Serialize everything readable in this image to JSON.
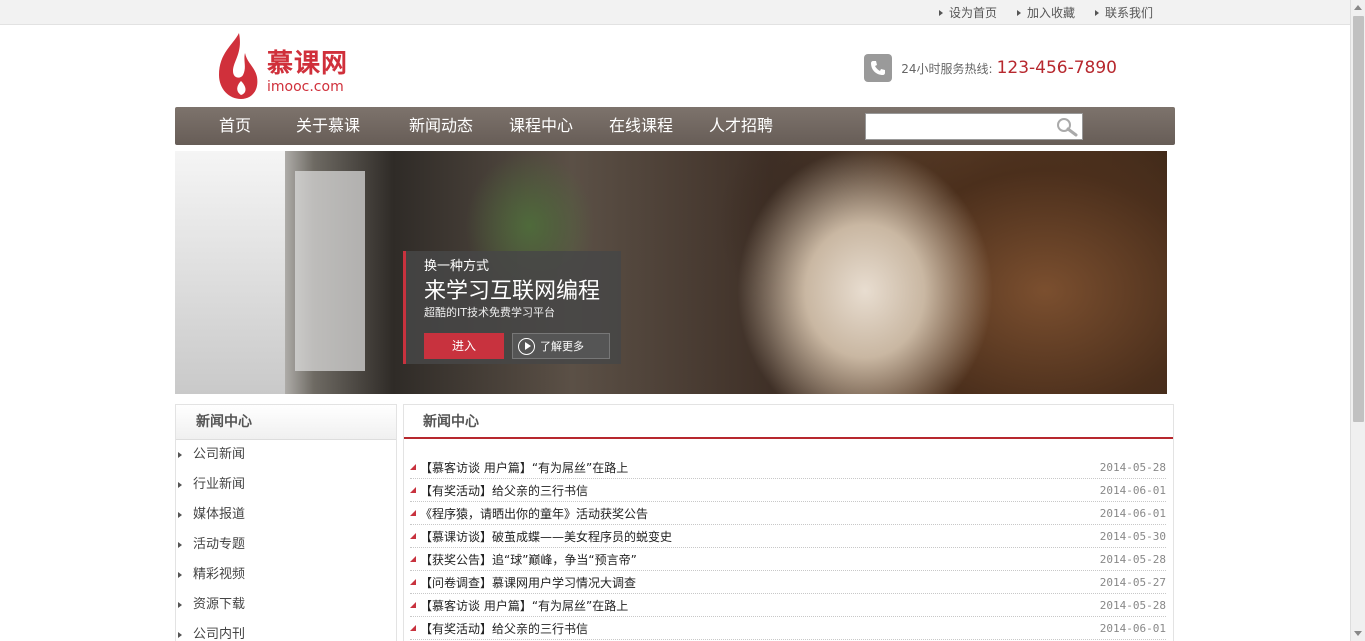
{
  "toplinks": [
    "设为首页",
    "加入收藏",
    "联系我们"
  ],
  "logo": {
    "cn": "慕课网",
    "en": "imooc.com"
  },
  "hotline": {
    "label": "24小时服务热线:",
    "number": "123-456-7890"
  },
  "nav": [
    "首页",
    "关于慕课",
    "新闻动态",
    "课程中心",
    "在线课程",
    "人才招聘"
  ],
  "search": {
    "value": ""
  },
  "banner": {
    "line1": "换一种方式",
    "line2": "来学习互联网编程",
    "line3": "超酷的IT技术免费学习平台",
    "enter_label": "进入",
    "more_label": "了解更多"
  },
  "sidebar": {
    "title": "新闻中心",
    "items": [
      "公司新闻",
      "行业新闻",
      "媒体报道",
      "活动专题",
      "精彩视频",
      "资源下载",
      "公司内刊"
    ]
  },
  "main": {
    "title": "新闻中心",
    "news": [
      {
        "title": "【慕客访谈 用户篇】“有为屌丝”在路上",
        "date": "2014-05-28"
      },
      {
        "title": "【有奖活动】给父亲的三行书信",
        "date": "2014-06-01"
      },
      {
        "title": "《程序猿，请晒出你的童年》活动获奖公告",
        "date": "2014-06-01"
      },
      {
        "title": "【慕课访谈】破茧成蝶——美女程序员的蜕变史",
        "date": "2014-05-30"
      },
      {
        "title": "【获奖公告】追“球”巅峰，争当“预言帝”",
        "date": "2014-05-28"
      },
      {
        "title": "【问卷调查】慕课网用户学习情况大调查",
        "date": "2014-05-27"
      },
      {
        "title": "【慕客访谈 用户篇】“有为屌丝”在路上",
        "date": "2014-05-28"
      },
      {
        "title": "【有奖活动】给父亲的三行书信",
        "date": "2014-06-01"
      }
    ]
  },
  "colors": {
    "accent": "#b7282e",
    "nav_bg": "#756b65"
  }
}
